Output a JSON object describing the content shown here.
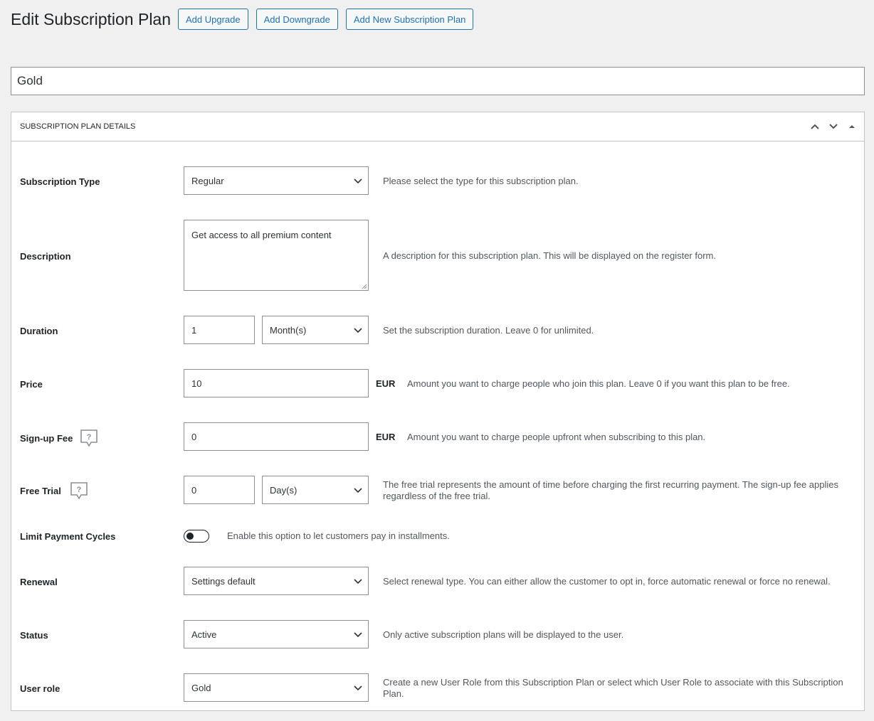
{
  "header": {
    "title": "Edit Subscription Plan",
    "buttons": [
      "Add Upgrade",
      "Add Downgrade",
      "Add New Subscription Plan"
    ]
  },
  "plan_name": "Gold",
  "panel": {
    "title": "SUBSCRIPTION PLAN DETAILS"
  },
  "fields": {
    "subscription_type": {
      "label": "Subscription Type",
      "value": "Regular",
      "description": "Please select the type for this subscription plan."
    },
    "description": {
      "label": "Description",
      "value": "Get access to all premium content",
      "description": "A description for this subscription plan. This will be displayed on the register form."
    },
    "duration": {
      "label": "Duration",
      "value": "1",
      "unit": "Month(s)",
      "description": "Set the subscription duration. Leave 0 for unlimited."
    },
    "price": {
      "label": "Price",
      "value": "10",
      "currency": "EUR",
      "description": "Amount you want to charge people who join this plan. Leave 0 if you want this plan to be free."
    },
    "signup_fee": {
      "label": "Sign-up Fee",
      "value": "0",
      "currency": "EUR",
      "description": "Amount you want to charge people upfront when subscribing to this plan."
    },
    "free_trial": {
      "label": "Free Trial",
      "value": "0",
      "unit": "Day(s)",
      "description": "The free trial represents the amount of time before charging the first recurring payment. The sign-up fee applies regardless of the free trial."
    },
    "limit_payment_cycles": {
      "label": "Limit Payment Cycles",
      "enabled": false,
      "description": "Enable this option to let customers pay in installments."
    },
    "renewal": {
      "label": "Renewal",
      "value": "Settings default",
      "description": "Select renewal type. You can either allow the customer to opt in, force automatic renewal or force no renewal."
    },
    "status": {
      "label": "Status",
      "value": "Active",
      "description": "Only active subscription plans will be displayed to the user."
    },
    "user_role": {
      "label": "User role",
      "value": "Gold",
      "description": "Create a new User Role from this Subscription Plan or select which User Role to associate with this Subscription Plan."
    }
  },
  "colors": {
    "accent": "#2271b1",
    "background": "#f0f0f1",
    "border": "#8c8f94"
  }
}
